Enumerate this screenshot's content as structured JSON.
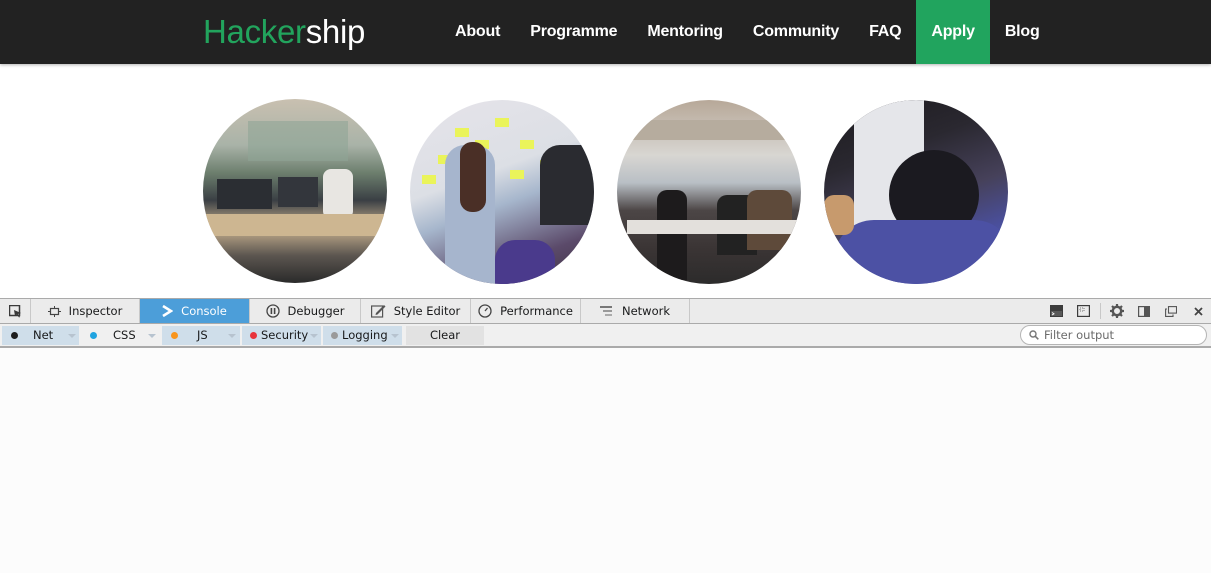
{
  "site": {
    "logo": {
      "part1": "Hacker",
      "part2": "ship"
    },
    "nav": [
      {
        "label": "About",
        "active": false
      },
      {
        "label": "Programme",
        "active": false
      },
      {
        "label": "Mentoring",
        "active": false
      },
      {
        "label": "Community",
        "active": false
      },
      {
        "label": "FAQ",
        "active": false
      },
      {
        "label": "Apply",
        "active": true
      },
      {
        "label": "Blog",
        "active": false
      }
    ],
    "colors": {
      "brand_green": "#22a45d",
      "header_bg": "#222222"
    },
    "photos": [
      {
        "subject": "people coding at desks in office"
      },
      {
        "subject": "people placing sticky notes on wall"
      },
      {
        "subject": "group standing around table in meeting room"
      },
      {
        "subject": "people looking at whiteboard"
      }
    ]
  },
  "devtools": {
    "tools": [
      {
        "label": "Inspector",
        "icon": "inspector-icon"
      },
      {
        "label": "Console",
        "icon": "console-icon",
        "active": true
      },
      {
        "label": "Debugger",
        "icon": "debugger-icon"
      },
      {
        "label": "Style Editor",
        "icon": "style-editor-icon"
      },
      {
        "label": "Performance",
        "icon": "performance-icon"
      },
      {
        "label": "Network",
        "icon": "network-icon"
      }
    ],
    "filters": [
      {
        "label": "Net",
        "dot_color": "#1d1d1d"
      },
      {
        "label": "CSS",
        "dot_color": "#1fa3e0"
      },
      {
        "label": "JS",
        "dot_color": "#f8951d"
      },
      {
        "label": "Security",
        "dot_color": "#e8343c"
      },
      {
        "label": "Logging",
        "dot_color": "#9a9a9a"
      }
    ],
    "clear_label": "Clear",
    "filter_placeholder": "Filter output",
    "accent_color": "#4c9ed9"
  }
}
